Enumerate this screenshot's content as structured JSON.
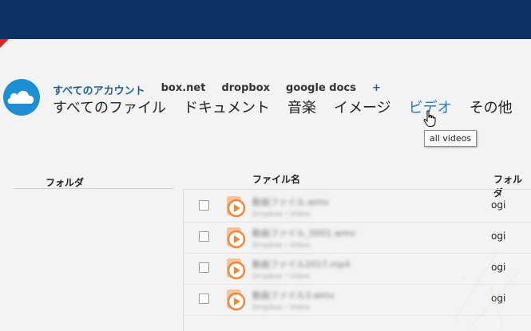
{
  "accounts": {
    "all": "すべてのアカウント",
    "items": [
      "box.net",
      "dropbox",
      "google docs"
    ],
    "add": "+"
  },
  "tabs": [
    "すべてのファイル",
    "ドキュメント",
    "音楽",
    "イメージ",
    "ビデオ",
    "その他"
  ],
  "active_tab": "ビデオ",
  "tooltip": "all videos",
  "sidebar": {
    "header": "フォルダ"
  },
  "table": {
    "columns": {
      "name": "ファイル名",
      "folder": "フォルダ"
    },
    "rows": [
      {
        "name": "動画ファイル.wmv",
        "source": "Dropbox・Video",
        "folder": "ogi"
      },
      {
        "name": "動画ファイル_0001.wmv",
        "source": "Dropbox・Video",
        "folder": "ogi"
      },
      {
        "name": "動画ファイル2017.mp4",
        "source": "Dropbox・Video",
        "folder": "ogi"
      },
      {
        "name": "動画ファイル3.wmv",
        "source": "Dropbox・Video",
        "folder": "ogi"
      }
    ]
  },
  "colors": {
    "topbar": "#0b3366",
    "accent": "#2a78c0",
    "logo": "#1e8fd2",
    "file_icon": "#f0883a"
  },
  "icons": {
    "logo": "cloud-logo-icon",
    "file": "video-file-icon",
    "cursor": "hand-cursor-icon"
  }
}
